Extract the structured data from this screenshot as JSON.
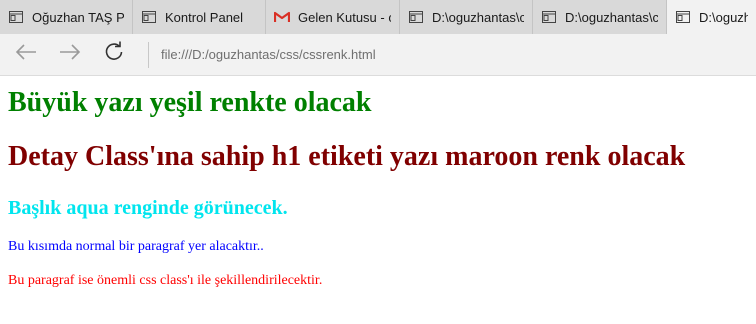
{
  "browser": {
    "tabs": [
      {
        "title": "Oğuzhan TAŞ Pro",
        "icon": "document-icon",
        "active": false
      },
      {
        "title": "Kontrol Panel",
        "icon": "document-icon",
        "active": false
      },
      {
        "title": "Gelen Kutusu - o",
        "icon": "gmail-icon",
        "active": false
      },
      {
        "title": "D:\\oguzhantas\\c",
        "icon": "document-icon",
        "active": false
      },
      {
        "title": "D:\\oguzhantas\\cs",
        "icon": "document-icon",
        "active": false
      },
      {
        "title": "D:\\oguzha",
        "icon": "document-icon",
        "active": true
      }
    ],
    "address_bar": {
      "url": "file:///D:/oguzhantas/css/cssrenk.html"
    }
  },
  "page": {
    "heading_green": "Büyük yazı yeşil renkte olacak",
    "heading_maroon": "Detay Class'ına sahip h1 etiketi yazı maroon renk olacak",
    "heading_aqua": "Başlık aqua renginde görünecek.",
    "paragraph_blue": "Bu kısımda normal bir paragraf yer alacaktır..",
    "paragraph_red": "Bu paragraf ise önemli css class'ı ile şekillendirilecektir."
  },
  "colors": {
    "green": "#008000",
    "maroon": "#800000",
    "aqua": "#00e5ee",
    "blue": "#0000ff",
    "red": "#ff0000",
    "gmail_red": "#d93025"
  }
}
